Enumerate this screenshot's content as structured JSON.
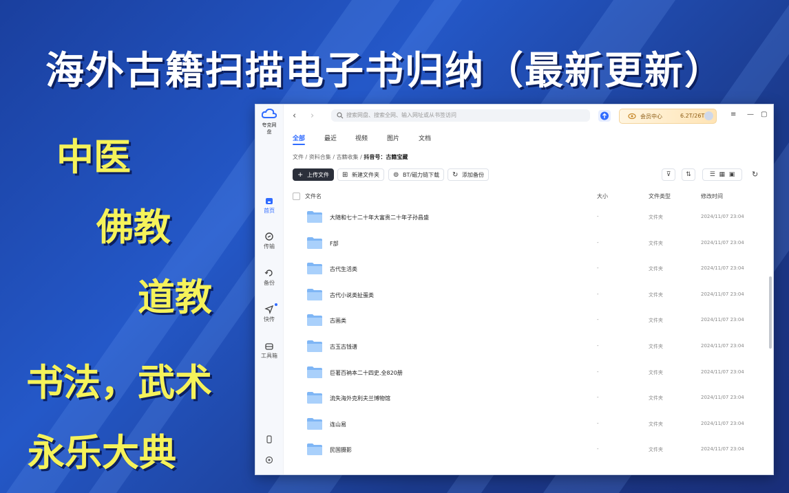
{
  "headline": "海外古籍扫描电子书归纳（最新更新）",
  "tags": [
    "中医",
    "佛教",
    "道教",
    "书法，武术",
    "永乐大典"
  ],
  "app": {
    "logo_text": "夸克网盘",
    "search_placeholder": "搜索网盘、搜索全网、输入网址或从书签访问",
    "member_label": "会员中心",
    "storage": "6.2T/26T",
    "sidebar": [
      {
        "label": "首页",
        "icon": "home-icon"
      },
      {
        "label": "传输",
        "icon": "transfer-icon"
      },
      {
        "label": "备份",
        "icon": "backup-icon"
      },
      {
        "label": "快传",
        "icon": "send-icon"
      },
      {
        "label": "工具箱",
        "icon": "toolbox-icon"
      }
    ],
    "tabs": [
      "全部",
      "最近",
      "视频",
      "图片",
      "文档"
    ],
    "breadcrumb": [
      "文件",
      "资料合集",
      "古籍收集",
      "抖音号：古籍宝藏"
    ],
    "toolbar": {
      "upload": "上传文件",
      "new_folder": "新建文件夹",
      "bt": "BT/磁力链下载",
      "add_backup": "添加备份"
    },
    "columns": {
      "name": "文件名",
      "size": "大小",
      "type": "文件类型",
      "modified": "修改时间"
    },
    "rows": [
      {
        "name": "大随和七十二十年大富贵二十年子孙昌盛",
        "size": "-",
        "type": "文件夹",
        "modified": "2024/11/07 23:04"
      },
      {
        "name": "F部",
        "size": "-",
        "type": "文件夹",
        "modified": "2024/11/07 23:04"
      },
      {
        "name": "古代生活类",
        "size": "-",
        "type": "文件夹",
        "modified": "2024/11/07 23:04"
      },
      {
        "name": "古代小说类扯蛋类",
        "size": "-",
        "type": "文件夹",
        "modified": "2024/11/07 23:04"
      },
      {
        "name": "古画类",
        "size": "-",
        "type": "文件夹",
        "modified": "2024/11/07 23:04"
      },
      {
        "name": "古玉古钱谱",
        "size": "-",
        "type": "文件夹",
        "modified": "2024/11/07 23:04"
      },
      {
        "name": "巨著百衲本二十四史.全820册",
        "size": "-",
        "type": "文件夹",
        "modified": "2024/11/07 23:04"
      },
      {
        "name": "流失海外克利夫兰博物馆",
        "size": "-",
        "type": "文件夹",
        "modified": "2024/11/07 23:04"
      },
      {
        "name": "连山易",
        "size": "-",
        "type": "文件夹",
        "modified": "2024/11/07 23:04"
      },
      {
        "name": "民国摄影",
        "size": "-",
        "type": "文件夹",
        "modified": "2024/11/07 23:04"
      }
    ]
  }
}
